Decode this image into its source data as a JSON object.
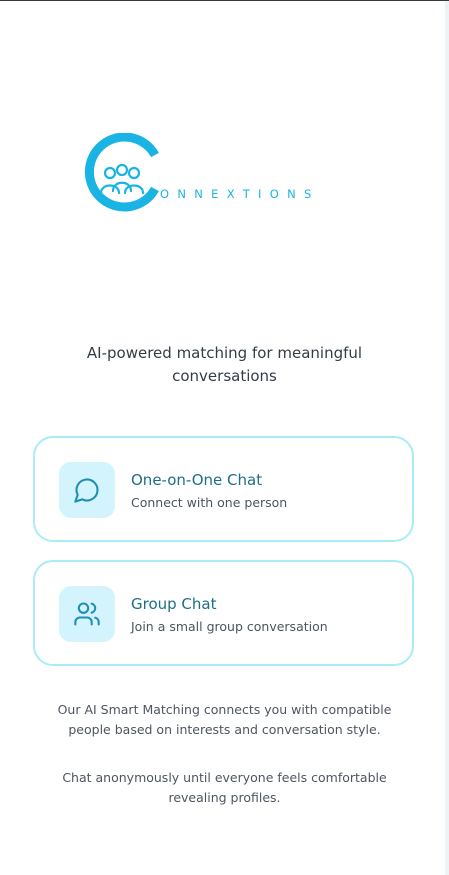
{
  "brand": {
    "name": "CONNEXTIONS",
    "initial": "C",
    "wordmark_rest": "ONNEXTIONS",
    "color": "#19b4e3"
  },
  "tagline": "AI-powered matching for meaningful conversations",
  "options": [
    {
      "title": "One-on-One Chat",
      "description": "Connect with one person",
      "icon": "message-circle-icon"
    },
    {
      "title": "Group Chat",
      "description": "Join a small group conversation",
      "icon": "users-icon"
    }
  ],
  "info": {
    "matching": "Our AI Smart Matching connects you with compatible people based on interests and conversation style.",
    "anonymity": "Chat anonymously until everyone feels comfortable revealing profiles."
  },
  "colors": {
    "accent": "#19b4e3",
    "card_border": "#a9ecf8",
    "icon_bg": "#d3f4fc",
    "title_text": "#1f6e89",
    "body_text": "#333d47"
  }
}
